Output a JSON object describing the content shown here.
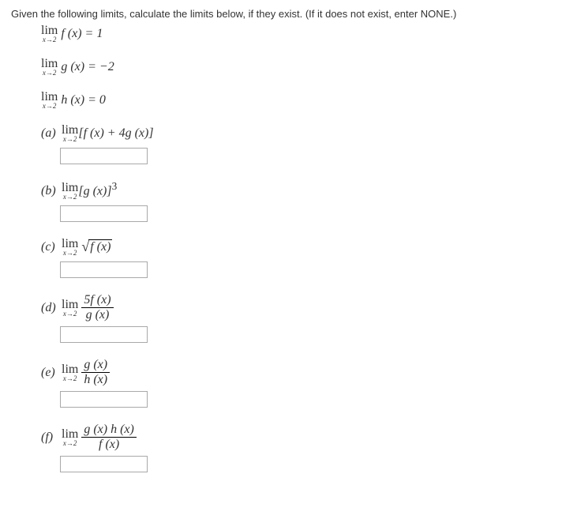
{
  "intro": "Given the following limits, calculate the limits below, if they exist. (If it does not exist, enter NONE.)",
  "given": {
    "f": {
      "limvar": "x→2",
      "expr": "f (x) = 1"
    },
    "g": {
      "limvar": "x→2",
      "expr": "g (x) = −2"
    },
    "h": {
      "limvar": "x→2",
      "expr": "h (x) = 0"
    }
  },
  "problems": {
    "a": {
      "label": "(a)",
      "limvar": "x→2",
      "expr": "[f (x) + 4g (x)]"
    },
    "b": {
      "label": "(b)",
      "limvar": "x→2",
      "expr_pre": "[g (x)]",
      "exp": "3"
    },
    "c": {
      "label": "(c)",
      "limvar": "x→2",
      "radicand": "f (x)"
    },
    "d": {
      "label": "(d)",
      "limvar": "x→2",
      "num": "5f (x)",
      "den": "g (x)"
    },
    "e": {
      "label": "(e)",
      "limvar": "x→2",
      "num": "g (x)",
      "den": "h (x)"
    },
    "f": {
      "label": "(f)",
      "limvar": "x→2",
      "num": "g (x) h (x)",
      "den": "f (x)"
    }
  }
}
